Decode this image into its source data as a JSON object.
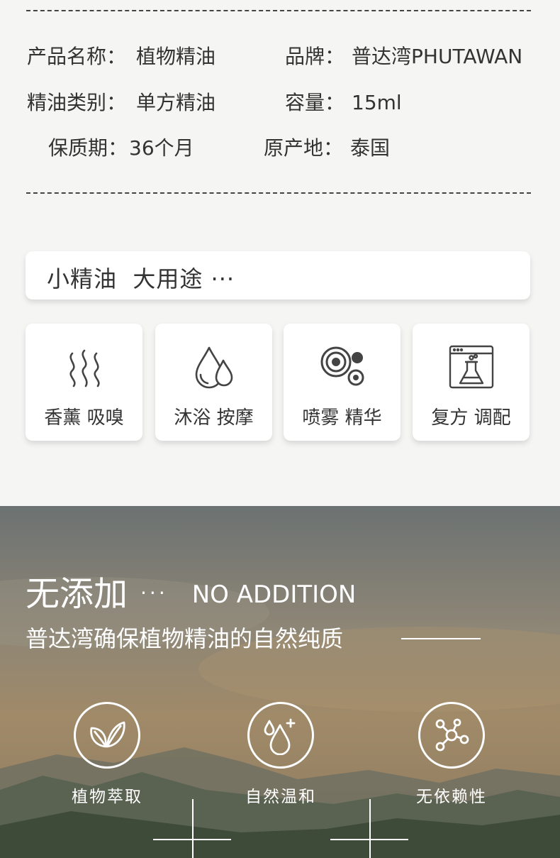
{
  "specs": [
    {
      "key": "产品名称：",
      "value": "植物精油"
    },
    {
      "key": "品牌：",
      "value": "普达湾PHUTAWAN"
    },
    {
      "key": "精油类别：",
      "value": "单方精油"
    },
    {
      "key": "容量：",
      "value": "15ml"
    },
    {
      "key": "保质期：",
      "value": "36个月"
    },
    {
      "key": "原产地：",
      "value": "泰国"
    }
  ],
  "banner": {
    "text": "小精油  大用途 ···"
  },
  "uses": [
    {
      "label": "香薰 吸嗅",
      "icon": "steam-icon"
    },
    {
      "label": "沐浴 按摩",
      "icon": "water-drops-icon"
    },
    {
      "label": "喷雾 精华",
      "icon": "spray-circles-icon"
    },
    {
      "label": "复方 调配",
      "icon": "lab-flask-icon"
    }
  ],
  "addition": {
    "title": "无添加",
    "dots": "···",
    "title_en": "NO ADDITION",
    "subtitle": "普达湾确保植物精油的自然纯质"
  },
  "features": [
    {
      "label": "植物萃取",
      "icon": "leaf-icon"
    },
    {
      "label": "自然温和",
      "icon": "drop-plus-icon"
    },
    {
      "label": "无依赖性",
      "icon": "molecule-icon"
    }
  ],
  "colors": {
    "background": "#f5f5f3",
    "card": "#ffffff",
    "text": "#333333",
    "overlay_text": "#ffffff"
  }
}
